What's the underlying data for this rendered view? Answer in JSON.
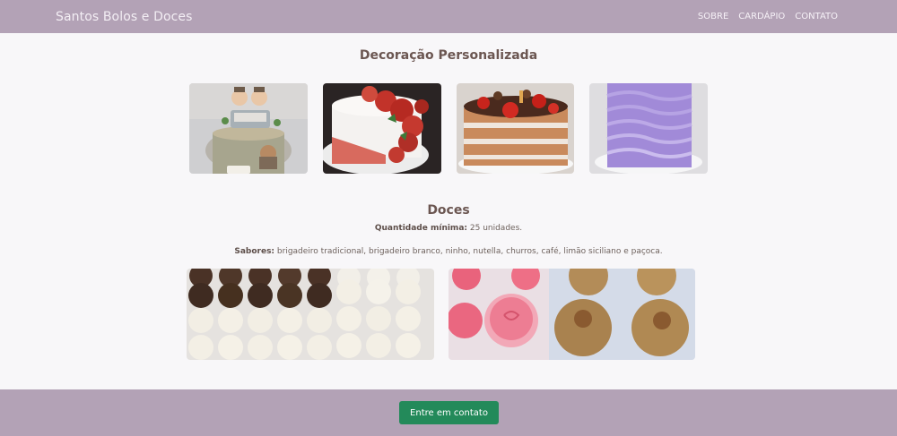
{
  "navbar": {
    "brand": "Santos Bolos e Doces",
    "links": [
      "SOBRE",
      "CARDÁPIO",
      "CONTATO"
    ]
  },
  "decoracao": {
    "title": "Decoração Personalizada",
    "images": [
      {
        "name": "cake-kids-figures-image"
      },
      {
        "name": "cake-red-flowers-image"
      },
      {
        "name": "cake-naked-strawberry-image"
      },
      {
        "name": "cake-lilac-waves-image"
      }
    ]
  },
  "doces": {
    "title": "Doces",
    "quantity_label": "Quantidade mínima:",
    "quantity_value": "25 unidades.",
    "flavors_label": "Sabores:",
    "flavors_value": "brigadeiro tradicional, brigadeiro branco, ninho, nutella, churros, café, limão siciliano e paçoca.",
    "images": [
      {
        "name": "brigadeiros-tray-image"
      },
      {
        "name": "pink-and-caramel-sweets-image"
      }
    ]
  },
  "footer": {
    "cta_label": "Entre em contato"
  },
  "colors": {
    "navbar": "#b3a2b6",
    "cta": "#238a5a",
    "background": "#f8f7f9"
  }
}
